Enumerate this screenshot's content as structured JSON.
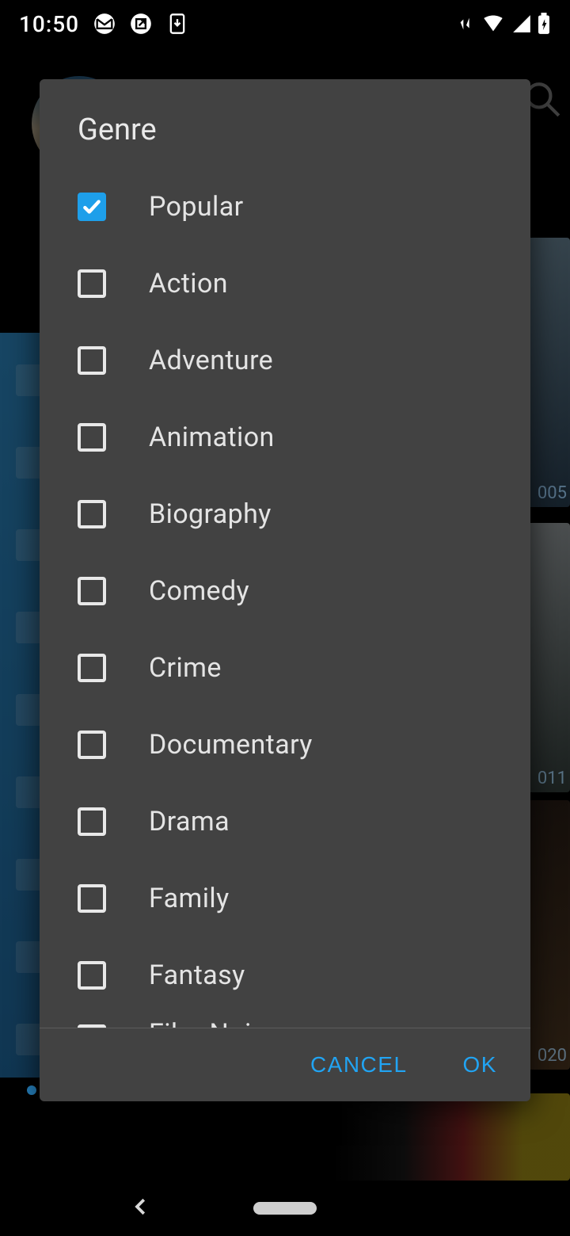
{
  "status": {
    "time": "10:50",
    "wifi_badge": "5"
  },
  "background": {
    "year_1": "005",
    "year_2": "011",
    "year_3": "020"
  },
  "dialog": {
    "title": "Genre",
    "genres": [
      {
        "label": "Popular",
        "checked": true
      },
      {
        "label": "Action",
        "checked": false
      },
      {
        "label": "Adventure",
        "checked": false
      },
      {
        "label": "Animation",
        "checked": false
      },
      {
        "label": "Biography",
        "checked": false
      },
      {
        "label": "Comedy",
        "checked": false
      },
      {
        "label": "Crime",
        "checked": false
      },
      {
        "label": "Documentary",
        "checked": false
      },
      {
        "label": "Drama",
        "checked": false
      },
      {
        "label": "Family",
        "checked": false
      },
      {
        "label": "Fantasy",
        "checked": false
      },
      {
        "label": "Film-Noir",
        "checked": false
      }
    ],
    "cancel_label": "CANCEL",
    "ok_label": "OK"
  }
}
